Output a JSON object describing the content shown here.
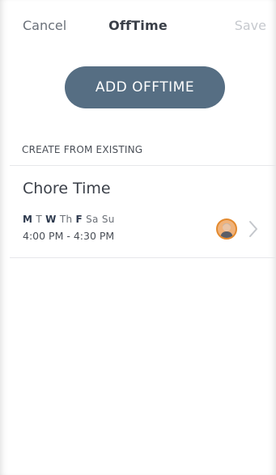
{
  "nav": {
    "cancel_label": "Cancel",
    "title": "OffTime",
    "save_label": "Save"
  },
  "add_button": {
    "label": "ADD OFFTIME"
  },
  "section": {
    "header": "CREATE FROM EXISTING"
  },
  "offtimes": [
    {
      "title": "Chore Time",
      "days": [
        {
          "label": "M",
          "active": true
        },
        {
          "label": "T",
          "active": false
        },
        {
          "label": "W",
          "active": true
        },
        {
          "label": "Th",
          "active": false
        },
        {
          "label": "F",
          "active": true
        },
        {
          "label": "Sa",
          "active": false
        },
        {
          "label": "Su",
          "active": false
        }
      ],
      "time_range": "4:00 PM - 4:30 PM",
      "avatar_icon": "user-avatar-icon",
      "chevron_icon": "chevron-right-icon"
    }
  ],
  "colors": {
    "button_bg": "#566e83",
    "avatar_ring": "#e38a2f",
    "save_disabled": "#c6c9ce"
  }
}
